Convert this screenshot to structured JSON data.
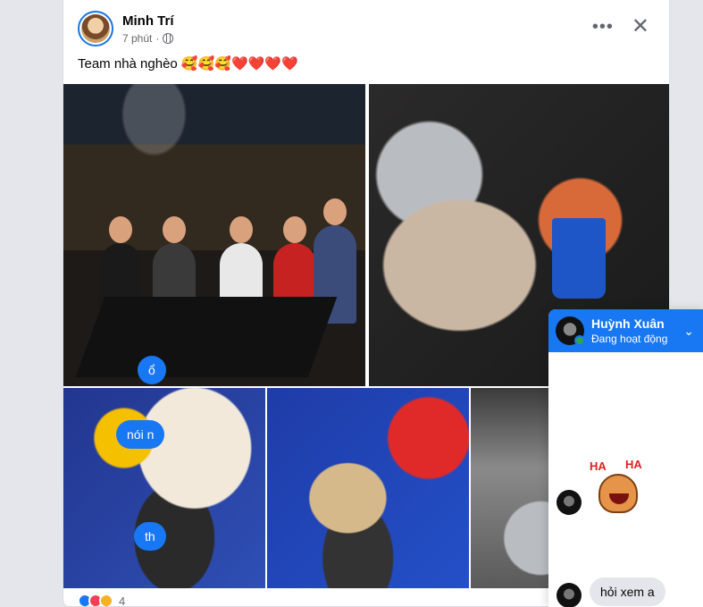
{
  "post": {
    "author": "Minh Trí",
    "time": "7 phút",
    "caption": "Team nhà nghèo 🥰🥰🥰❤️❤️❤️❤️",
    "reaction_count": "4"
  },
  "icons": {
    "more": "more-horizontal-icon",
    "close": "close-icon",
    "privacy": "globe-icon"
  },
  "chat": {
    "name": "Huỳnh Xuân",
    "status": "Đang hoạt động",
    "messages_out": [
      "ổ",
      "nói n",
      "th"
    ],
    "message_in": "hỏi xem a",
    "sticker_text": [
      "HA",
      "HA"
    ]
  },
  "colors": {
    "accent": "#1877f2",
    "online": "#31a24c"
  }
}
